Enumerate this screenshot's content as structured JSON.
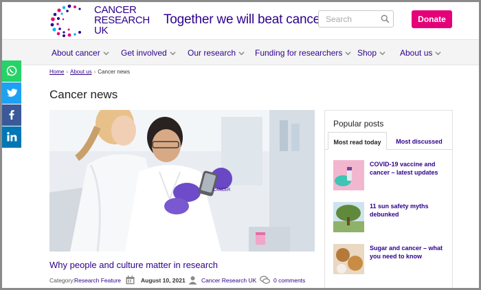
{
  "brand": {
    "logo_line1": "CANCER",
    "logo_line2": "RESEARCH",
    "logo_line3": "UK",
    "tagline": "Together we will beat cancer",
    "accent": "#e40078",
    "primary": "#2e008b"
  },
  "search": {
    "placeholder": "Search",
    "icon": "search-icon"
  },
  "donate": {
    "label": "Donate"
  },
  "nav": [
    {
      "label": "About cancer"
    },
    {
      "label": "Get involved"
    },
    {
      "label": "Our research"
    },
    {
      "label": "Funding for researchers"
    },
    {
      "label": "Shop"
    },
    {
      "label": "About us"
    }
  ],
  "social": [
    {
      "icon": "whatsapp-icon",
      "color": "#25d366"
    },
    {
      "icon": "twitter-icon",
      "color": "#1da1f2"
    },
    {
      "icon": "facebook-icon",
      "color": "#3b5998"
    },
    {
      "icon": "linkedin-icon",
      "color": "#0077b5"
    }
  ],
  "breadcrumb": {
    "home": "Home",
    "about": "About us",
    "sep": "›",
    "current": "Cancer news"
  },
  "page": {
    "title": "Cancer news"
  },
  "article": {
    "title": "Why people and culture matter in research",
    "category_label": "Category:",
    "category": "Research Feature",
    "date": "August 10, 2021",
    "author": "Cancer Research UK",
    "comments": "0 comments"
  },
  "popular": {
    "title": "Popular posts",
    "tabs": [
      {
        "label": "Most read today"
      },
      {
        "label": "Most discussed"
      }
    ],
    "posts": [
      {
        "title": "COVID-19 vaccine and cancer – latest updates"
      },
      {
        "title": "11 sun safety myths debunked"
      },
      {
        "title": "Sugar and cancer – what you need to know"
      }
    ]
  }
}
